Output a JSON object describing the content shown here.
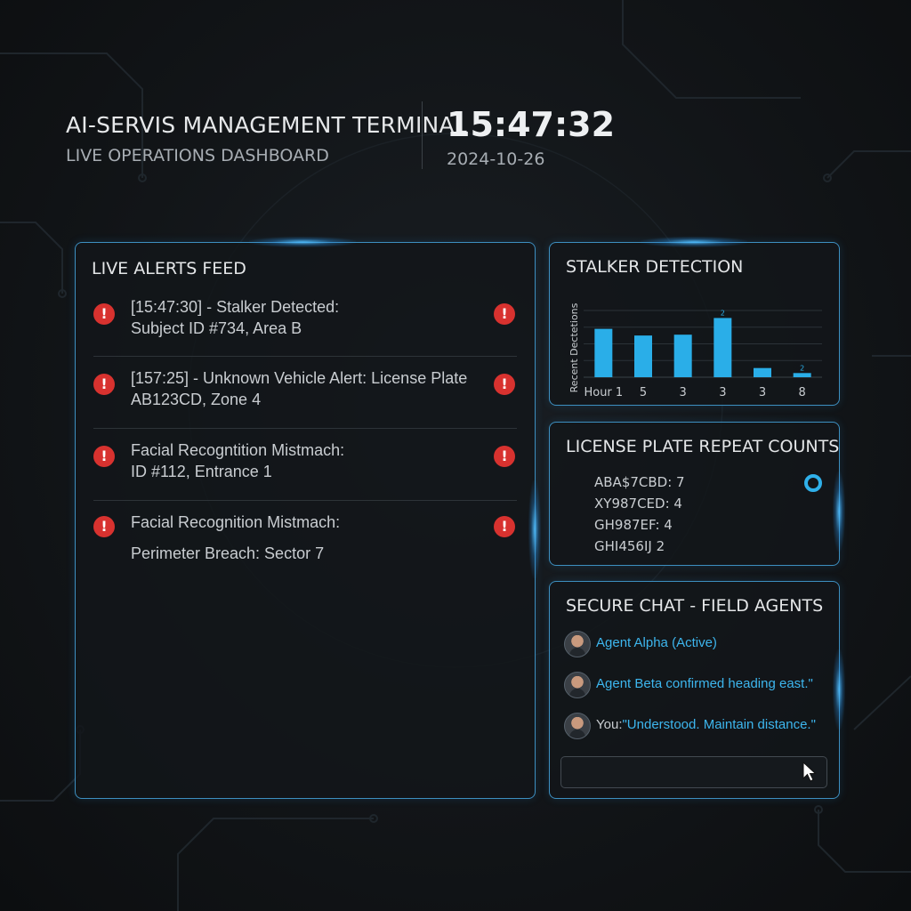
{
  "header": {
    "title": "AI-SERVIS MANAGEMENT TERMINAL",
    "subtitle": "LIVE OPERATIONS DASHBOARD",
    "time": "15:47:32",
    "date": "2024-10-26"
  },
  "alerts": {
    "title": "LIVE ALERTS FEED",
    "items": [
      {
        "line1": "[15:47:30] - Stalker Detected:",
        "line2": "Subject ID #734, Area B",
        "icon": "alert-icon"
      },
      {
        "line1": "[157:25] - Unknown Vehicle Alert: License Plate",
        "line2": "AB123CD, Zone 4",
        "icon": "alert-icon"
      },
      {
        "line1": "Facial Recogntition Mistmach:",
        "line2": "ID #112, Entrance 1",
        "icon": "alert-icon"
      },
      {
        "line1": "Facial Recognition Mistmach:",
        "line2": "Perimeter Breach: Sector 7",
        "icon": "alert-icon"
      }
    ]
  },
  "stalker": {
    "title": "STALKER DETECTION",
    "chart_data": {
      "type": "bar",
      "title": "STALKER DETECTION",
      "ylabel": "Recent Dectetions",
      "xlabel": "",
      "categories": [
        "Hour 1",
        "5",
        "3",
        "3",
        "3",
        "8"
      ],
      "values": [
        5.8,
        5.0,
        5.1,
        7.1,
        1.1,
        0.5
      ],
      "data_labels": [
        "",
        "",
        "",
        "2",
        "",
        "2"
      ],
      "ylim": [
        0,
        8
      ],
      "grid": true,
      "color": "#2aaee8"
    }
  },
  "plates": {
    "title": "LICENSE PLATE REPEAT COUNTS",
    "items": [
      "ABA$7CBD: 7",
      "XY987CED: 4",
      "GH987EF: 4",
      "GHI456IJ  2"
    ],
    "indicator_icon": "ring-icon"
  },
  "chat": {
    "title": "SECURE CHAT - FIELD AGENTS",
    "messages": [
      {
        "text": "Agent Alpha (Active)",
        "avatar": "agent-avatar"
      },
      {
        "text": "Agent Beta confirmed heading east.\"",
        "avatar": "agent-avatar"
      },
      {
        "prefix": "You:",
        "text": "\"Understood. Maintain distance.\"",
        "avatar": "user-avatar"
      }
    ],
    "input_placeholder": ""
  },
  "colors": {
    "accent": "#2aaee8",
    "panel_border": "#3d8fc0",
    "alert": "#d8322f",
    "background": "#121518"
  }
}
